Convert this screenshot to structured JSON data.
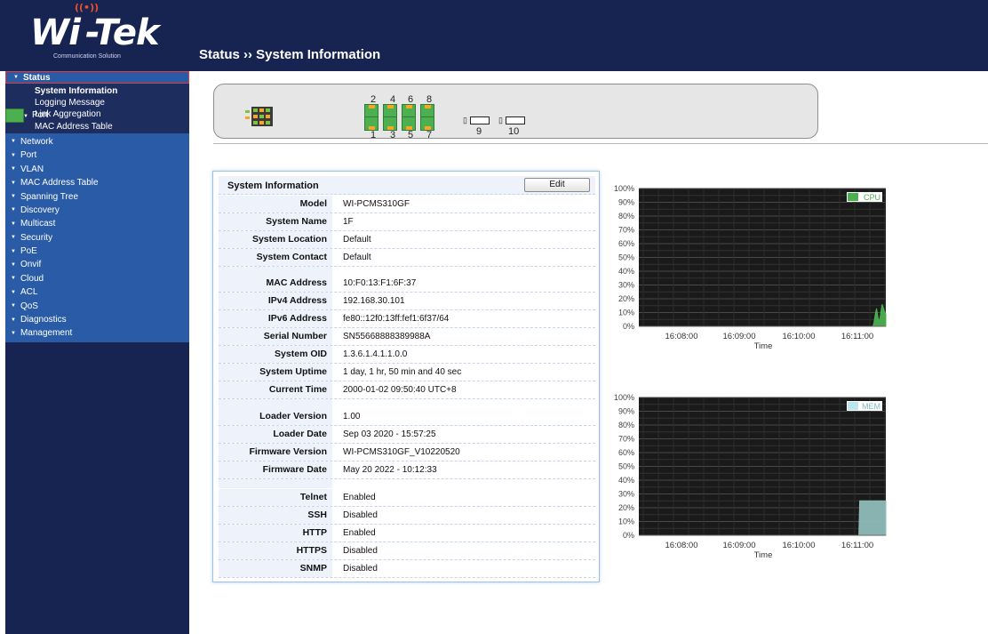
{
  "header": {
    "logo_text": "Wi-Tek",
    "logo_tagline": "Communication Solution",
    "title": "Status ›› System Information"
  },
  "sidebar": {
    "status_label": "Status",
    "status_children": [
      "System Information",
      "Logging Message"
    ],
    "port_label": "Port",
    "port_children": [
      "Link Aggregation",
      "MAC Address Table"
    ],
    "items": [
      "Network",
      "Port",
      "VLAN",
      "MAC Address Table",
      "Spanning Tree",
      "Discovery",
      "Multicast",
      "Security",
      "PoE",
      "Onvif",
      "Cloud",
      "ACL",
      "QoS",
      "Diagnostics",
      "Management"
    ]
  },
  "panel": {
    "top_port_numbers": [
      "2",
      "4",
      "6",
      "8"
    ],
    "bottom_port_numbers": [
      "1",
      "3",
      "5",
      "7"
    ],
    "sfp_port_numbers": [
      "9",
      "10"
    ]
  },
  "info": {
    "title": "System Information",
    "edit_label": "Edit",
    "groups": [
      [
        {
          "key": "Model",
          "value": "WI-PCMS310GF"
        },
        {
          "key": "System Name",
          "value": "1F"
        },
        {
          "key": "System Location",
          "value": "Default"
        },
        {
          "key": "System Contact",
          "value": "Default"
        }
      ],
      [
        {
          "key": "MAC Address",
          "value": "10:F0:13:F1:6F:37"
        },
        {
          "key": "IPv4 Address",
          "value": "192.168.30.101"
        },
        {
          "key": "IPv6 Address",
          "value": "fe80::12f0:13ff:fef1:6f37/64"
        },
        {
          "key": "Serial Number",
          "value": "SN55668888389988A"
        },
        {
          "key": "System OID",
          "value": "1.3.6.1.4.1.1.0.0"
        },
        {
          "key": "System Uptime",
          "value": "1 day, 1 hr, 50 min and 40 sec"
        },
        {
          "key": "Current Time",
          "value": "2000-01-02 09:50:40 UTC+8"
        }
      ],
      [
        {
          "key": "Loader Version",
          "value": "1.00"
        },
        {
          "key": "Loader Date",
          "value": "Sep 03 2020 - 15:57:25"
        },
        {
          "key": "Firmware Version",
          "value": "WI-PCMS310GF_V10220520"
        },
        {
          "key": "Firmware Date",
          "value": "May 20 2022 - 10:12:33"
        }
      ],
      [
        {
          "key": "Telnet",
          "value": "Enabled"
        },
        {
          "key": "SSH",
          "value": "Disabled"
        },
        {
          "key": "HTTP",
          "value": "Enabled"
        },
        {
          "key": "HTTPS",
          "value": "Disabled"
        },
        {
          "key": "SNMP",
          "value": "Disabled"
        }
      ]
    ]
  },
  "colors": {
    "header_bg": "#172452",
    "sidebar_item_bg": "#2a5ba6",
    "chart_bg": "#1a1a1a",
    "cpu_fill": "#4caf50",
    "mem_fill": "#8fbcb8",
    "mem_legend": "#b9e6ef"
  },
  "chart_data": [
    {
      "type": "area",
      "series": [
        {
          "name": "CPU",
          "values": [
            0,
            0,
            0,
            0,
            0,
            0,
            0,
            0,
            0,
            0,
            0,
            0,
            0,
            0,
            0,
            0,
            0,
            0,
            0,
            0,
            0,
            0,
            0,
            0,
            0,
            0,
            0,
            0,
            0,
            0,
            0,
            0,
            0,
            0,
            0,
            0,
            0,
            0,
            0,
            0,
            0,
            0,
            0,
            0,
            0,
            0,
            0,
            0,
            0,
            0,
            0,
            0,
            0,
            0,
            0,
            0,
            0,
            0,
            0,
            0,
            0,
            0,
            0,
            0,
            0,
            0,
            0,
            0,
            0,
            0,
            0,
            0,
            0,
            0,
            0,
            0,
            0,
            0,
            0,
            0,
            0,
            0,
            0,
            0,
            0,
            0,
            0,
            0,
            0,
            0,
            0,
            0,
            0,
            0,
            0,
            0,
            0,
            0,
            0,
            0,
            0,
            0,
            0,
            0,
            0,
            0,
            0,
            0,
            0,
            0,
            0,
            0,
            0,
            0,
            0,
            0,
            0,
            0,
            0,
            0,
            0,
            0,
            0,
            0,
            0,
            0,
            0,
            0,
            0,
            0,
            0,
            0,
            0,
            0,
            0,
            0,
            0,
            0,
            0,
            0,
            0,
            0,
            0,
            0,
            0,
            0,
            0,
            0,
            0,
            0,
            0,
            0,
            0,
            0,
            0,
            0,
            0,
            0,
            0,
            0,
            0,
            0,
            0,
            0,
            0,
            0,
            0,
            0,
            0,
            0,
            0,
            0,
            0,
            0,
            0,
            0,
            0,
            0,
            0,
            0,
            0,
            0,
            0,
            0,
            0,
            0,
            0,
            0,
            0,
            0,
            0,
            0,
            0,
            0,
            0,
            0,
            0,
            0,
            0,
            0,
            0,
            0,
            0,
            0,
            0,
            0,
            0,
            0,
            0,
            0,
            0,
            0,
            0,
            0,
            0,
            0,
            0,
            0,
            0,
            0,
            0,
            0,
            0,
            0,
            0,
            0,
            0,
            0,
            0,
            0,
            0,
            0,
            0,
            0,
            0,
            0,
            0,
            0,
            0,
            0,
            0,
            0,
            0,
            0,
            0,
            0,
            0,
            0,
            0,
            0,
            0,
            0,
            0,
            2,
            6,
            10,
            13,
            9,
            5,
            4,
            7,
            12,
            16,
            14,
            12,
            10,
            9
          ]
        }
      ],
      "x_tick_labels": [
        "16:08:00",
        "16:09:00",
        "16:10:00",
        "16:11:00"
      ],
      "xlabel": "Time",
      "yticks": [
        "0%",
        "10%",
        "20%",
        "30%",
        "40%",
        "50%",
        "60%",
        "70%",
        "80%",
        "90%",
        "100%"
      ],
      "ylim": [
        0,
        100
      ],
      "grid": true,
      "legend": "top-right"
    },
    {
      "type": "area",
      "series": [
        {
          "name": "MEM",
          "values": [
            0,
            0,
            0,
            0,
            0,
            0,
            0,
            0,
            0,
            0,
            0,
            0,
            0,
            0,
            0,
            0,
            0,
            0,
            0,
            0,
            0,
            0,
            0,
            0,
            0,
            0,
            0,
            0,
            0,
            0,
            0,
            0,
            0,
            0,
            0,
            0,
            0,
            0,
            0,
            0,
            0,
            0,
            0,
            0,
            0,
            0,
            0,
            0,
            0,
            0,
            0,
            0,
            0,
            0,
            0,
            0,
            0,
            0,
            0,
            0,
            0,
            0,
            0,
            0,
            0,
            0,
            0,
            0,
            0,
            0,
            0,
            0,
            0,
            0,
            0,
            0,
            0,
            0,
            0,
            0,
            0,
            0,
            0,
            0,
            0,
            0,
            0,
            0,
            0,
            0,
            0,
            0,
            0,
            0,
            0,
            0,
            0,
            0,
            0,
            0,
            0,
            0,
            0,
            0,
            0,
            0,
            0,
            0,
            0,
            0,
            0,
            0,
            0,
            0,
            0,
            0,
            0,
            0,
            0,
            0,
            0,
            0,
            0,
            0,
            0,
            0,
            0,
            0,
            0,
            0,
            0,
            0,
            0,
            0,
            0,
            0,
            0,
            0,
            0,
            0,
            0,
            0,
            0,
            0,
            0,
            0,
            0,
            0,
            0,
            0,
            0,
            0,
            0,
            0,
            0,
            0,
            0,
            0,
            0,
            0,
            0,
            0,
            0,
            0,
            0,
            0,
            0,
            0,
            0,
            0,
            0,
            0,
            0,
            0,
            0,
            0,
            0,
            0,
            0,
            0,
            0,
            0,
            0,
            0,
            0,
            0,
            0,
            0,
            0,
            0,
            0,
            0,
            0,
            0,
            0,
            0,
            0,
            0,
            0,
            0,
            0,
            0,
            0,
            0,
            0,
            0,
            0,
            0,
            0,
            0,
            0,
            0,
            0,
            0,
            0,
            0,
            0,
            0,
            0,
            0,
            0,
            0,
            0,
            0,
            0,
            0,
            0,
            0,
            0,
            0,
            0,
            0,
            0,
            0,
            0,
            0,
            0,
            0,
            0,
            0,
            0,
            0,
            0,
            0,
            0,
            0,
            0,
            0,
            0,
            0,
            0,
            0,
            0,
            0,
            0,
            0,
            0,
            0,
            0,
            0,
            0,
            0,
            25,
            25,
            25,
            25,
            25,
            25,
            25,
            25,
            25,
            25,
            25,
            25,
            25,
            25,
            25,
            25,
            25,
            25,
            25,
            25,
            25,
            25,
            25,
            25,
            25,
            25,
            25,
            25,
            25,
            25,
            25,
            25
          ]
        }
      ],
      "x_tick_labels": [
        "16:08:00",
        "16:09:00",
        "16:10:00",
        "16:11:00"
      ],
      "xlabel": "Time",
      "yticks": [
        "0%",
        "10%",
        "20%",
        "30%",
        "40%",
        "50%",
        "60%",
        "70%",
        "80%",
        "90%",
        "100%"
      ],
      "ylim": [
        0,
        100
      ],
      "grid": true,
      "legend": "top-right"
    }
  ]
}
